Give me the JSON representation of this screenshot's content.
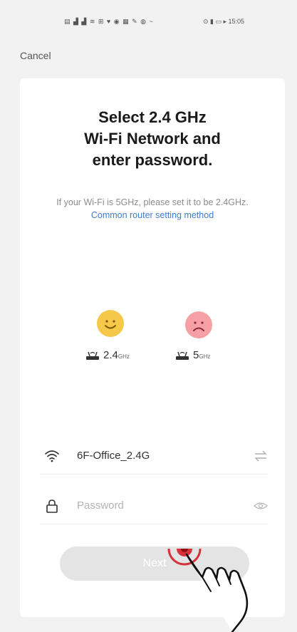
{
  "status_bar": {
    "left_icons": "▤ ▟ ▟ ≋ ⊞ ♥ ◉ ▦ ✎ ◍ ~",
    "right_text": "⊙ ▮ ▭ ▸ 15:05"
  },
  "nav": {
    "cancel_label": "Cancel"
  },
  "header": {
    "title_lines": [
      "Select 2.4 GHz",
      "Wi-Fi Network and",
      "enter password."
    ],
    "subtitle_text": "If your Wi-Fi is 5GHz, please set it to be 2.4GHz. ",
    "subtitle_link": "Common router setting method"
  },
  "bands": [
    {
      "value": "2.4",
      "unit": "GHz",
      "mood": "happy"
    },
    {
      "value": "5",
      "unit": "GHz",
      "mood": "sad"
    }
  ],
  "form": {
    "wifi_name": "6F-Office_2.4G",
    "password_placeholder": "Password"
  },
  "next_button": {
    "label": "Next"
  },
  "colors": {
    "background": "#f2f2f2",
    "card": "#ffffff",
    "link": "#3e7bd8",
    "happy_face": "#f5c84a",
    "sad_face": "#f5a0a4",
    "button_disabled": "#e4e4e4",
    "tap_highlight": "#d6323c"
  },
  "icons": [
    "wifi-icon",
    "swap-icon",
    "lock-icon",
    "eye-icon",
    "router-icon",
    "hand-pointer-icon"
  ]
}
